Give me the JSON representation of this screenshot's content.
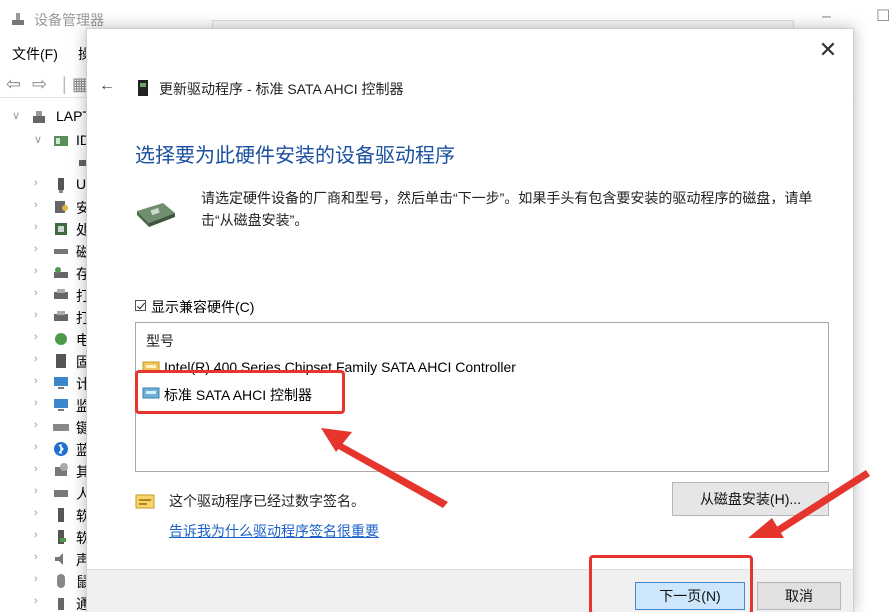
{
  "background_window": {
    "title": "设备管理器",
    "menu": [
      "文件(F)",
      "操"
    ],
    "tree_root": "LAPT",
    "tree_items": [
      "IDE",
      "U",
      "安",
      "处",
      "磁",
      "存",
      "打",
      "打",
      "电",
      "固",
      "计",
      "监",
      "键",
      "蓝",
      "其",
      "人",
      "软",
      "软",
      "声",
      "鼠",
      "通"
    ]
  },
  "dialog": {
    "title": "更新驱动程序 - 标准 SATA AHCI 控制器",
    "heading": "选择要为此硬件安装的设备驱动程序",
    "description": "请选定硬件设备的厂商和型号，然后单击“下一步”。如果手头有包含要安装的驱动程序的磁盘，请单击“从磁盘安装”。",
    "show_compatible_label": "显示兼容硬件(C)",
    "show_compatible_checked": true,
    "model_column_header": "型号",
    "models": [
      {
        "label": "Intel(R) 400 Series Chipset Family SATA AHCI Controller",
        "selected": false
      },
      {
        "label": "标准 SATA AHCI 控制器",
        "selected": true
      }
    ],
    "signature_text": "这个驱动程序已经过数字签名。",
    "signature_link": "告诉我为什么驱动程序签名很重要",
    "have_disk_label": "从磁盘安装(H)...",
    "next_label": "下一页(N)",
    "cancel_label": "取消"
  },
  "colors": {
    "heading": "#1b4fa0",
    "link": "#1a62c9",
    "annotation": "#e5352d",
    "next_button_bg": "#cde6fb"
  }
}
